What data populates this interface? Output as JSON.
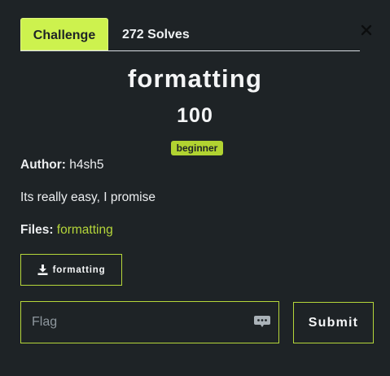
{
  "tabs": {
    "challenge_label": "Challenge",
    "solves_label": "272 Solves"
  },
  "challenge": {
    "name": "formatting",
    "value": "100",
    "category_badge": "beginner",
    "author_label": "Author:",
    "author": "h4sh5",
    "description": "Its really easy, I promise",
    "files_label": "Files:",
    "file_name": "formatting",
    "download_button_label": "formatting"
  },
  "flag_form": {
    "placeholder": "Flag",
    "value": "",
    "submit_label": "Submit"
  },
  "icons": {
    "close": "close-icon",
    "download": "download-icon",
    "password_manager": "password-dots-icon"
  },
  "colors": {
    "background": "#1e2326",
    "accent": "#b5d63a",
    "active_tab": "#cdf24e",
    "badge": "#b1d331"
  }
}
